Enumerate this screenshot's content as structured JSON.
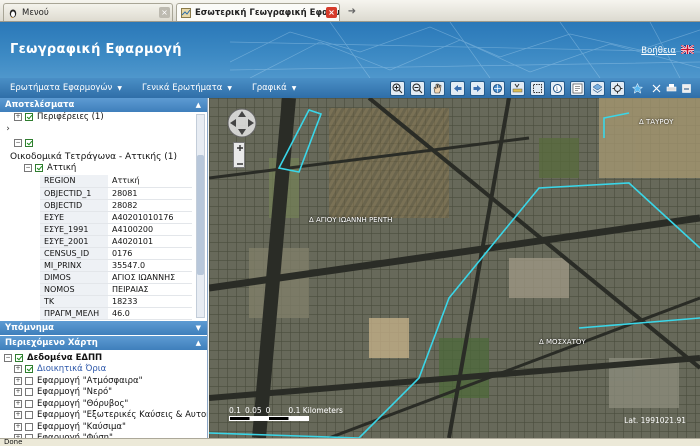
{
  "browser": {
    "tabs": [
      {
        "label": "Μενού",
        "active": false
      },
      {
        "label": "Εσωτερική Γεωγραφική Εφαρμογή",
        "active": true
      }
    ],
    "new_tab_symbol": "➜"
  },
  "header": {
    "title": "Γεωγραφική Εφαρμογή",
    "help_label": "Βοήθεια"
  },
  "menubar": {
    "items": [
      {
        "label": "Ερωτήματα Εφαρμογών"
      },
      {
        "label": "Γενικά Ερωτήματα"
      },
      {
        "label": "Γραφικά"
      }
    ],
    "tools": [
      "zoom-in-icon",
      "zoom-out-icon",
      "pan-icon",
      "back-icon",
      "forward-icon",
      "full-extent-icon",
      "measure-icon",
      "select-icon",
      "identify-icon",
      "info-icon",
      "layers-icon",
      "locate-icon",
      "star-icon"
    ],
    "right_tools": [
      "clear-icon",
      "print-icon",
      "export-icon"
    ]
  },
  "results_panel": {
    "title": "Αποτελέσματα",
    "peripheries_label": "Περιφέρειες (1)",
    "blocks_label": "Οικοδομικά Τετράγωνα - Αττικής (1)",
    "attica_label": "Αττική",
    "attributes": [
      {
        "key": "REGION",
        "value": "Αττική"
      },
      {
        "key": "OBJECTID_1",
        "value": "28081"
      },
      {
        "key": "OBJECTID",
        "value": "28082"
      },
      {
        "key": "ΕΣΥΕ",
        "value": "A40201010176"
      },
      {
        "key": "ΕΣΥΕ_1991",
        "value": "A4100200"
      },
      {
        "key": "ΕΣΥΕ_2001",
        "value": "A4020101"
      },
      {
        "key": "CENSUS_ID",
        "value": "0176"
      },
      {
        "key": "MI_PRINX",
        "value": "35547.0"
      },
      {
        "key": "DIMOS",
        "value": "ΑΓΙΟΣ ΙΩΑΝΝΗΣ"
      },
      {
        "key": "NOMOS",
        "value": "ΠΕΙΡΑΙΑΣ"
      },
      {
        "key": "TK",
        "value": "18233"
      },
      {
        "key": "ΠΡΑΓΜ_ΜΕΛΗ",
        "value": "46.0"
      }
    ]
  },
  "legend_panel": {
    "title": "Υπόμνημα"
  },
  "content_panel": {
    "title": "Περιεχόμενο Χάρτη",
    "root_label": "Δεδομένα ΕΔΠΠ",
    "layers": [
      {
        "label": "Διοικητικά Όρια",
        "checked": true
      },
      {
        "label": "Εφαρμογή \"Ατμόσφαιρα\"",
        "checked": false
      },
      {
        "label": "Εφαρμογή \"Νερό\"",
        "checked": false
      },
      {
        "label": "Εφαρμογή \"Θόρυβος\"",
        "checked": false
      },
      {
        "label": "Εφαρμογή \"Εξωτερικές Καύσεις & Αυτοκίνητα\"",
        "checked": false
      },
      {
        "label": "Εφαρμογή \"Καύσιμα\"",
        "checked": false
      },
      {
        "label": "Εφαρμογή \"Φύση\"",
        "checked": false
      }
    ]
  },
  "map": {
    "labels": [
      {
        "text": "Δ ΤΑΥΡΟΥ"
      },
      {
        "text": "Δ ΑΓΙΟΥ ΙΩΑΝΝΗ ΡΕΝΤΗ"
      },
      {
        "text": "Δ ΜΟΣΧΑΤΟΥ"
      }
    ],
    "scale": {
      "ticks": [
        "0.1",
        "0.05",
        "0",
        "0.1 Kilometers"
      ]
    },
    "coordinates": "Lat. 1991021.91"
  },
  "status": {
    "text": "Done"
  },
  "colors": {
    "accent": "#2f6ea8",
    "boundary": "#3ad6e8"
  }
}
